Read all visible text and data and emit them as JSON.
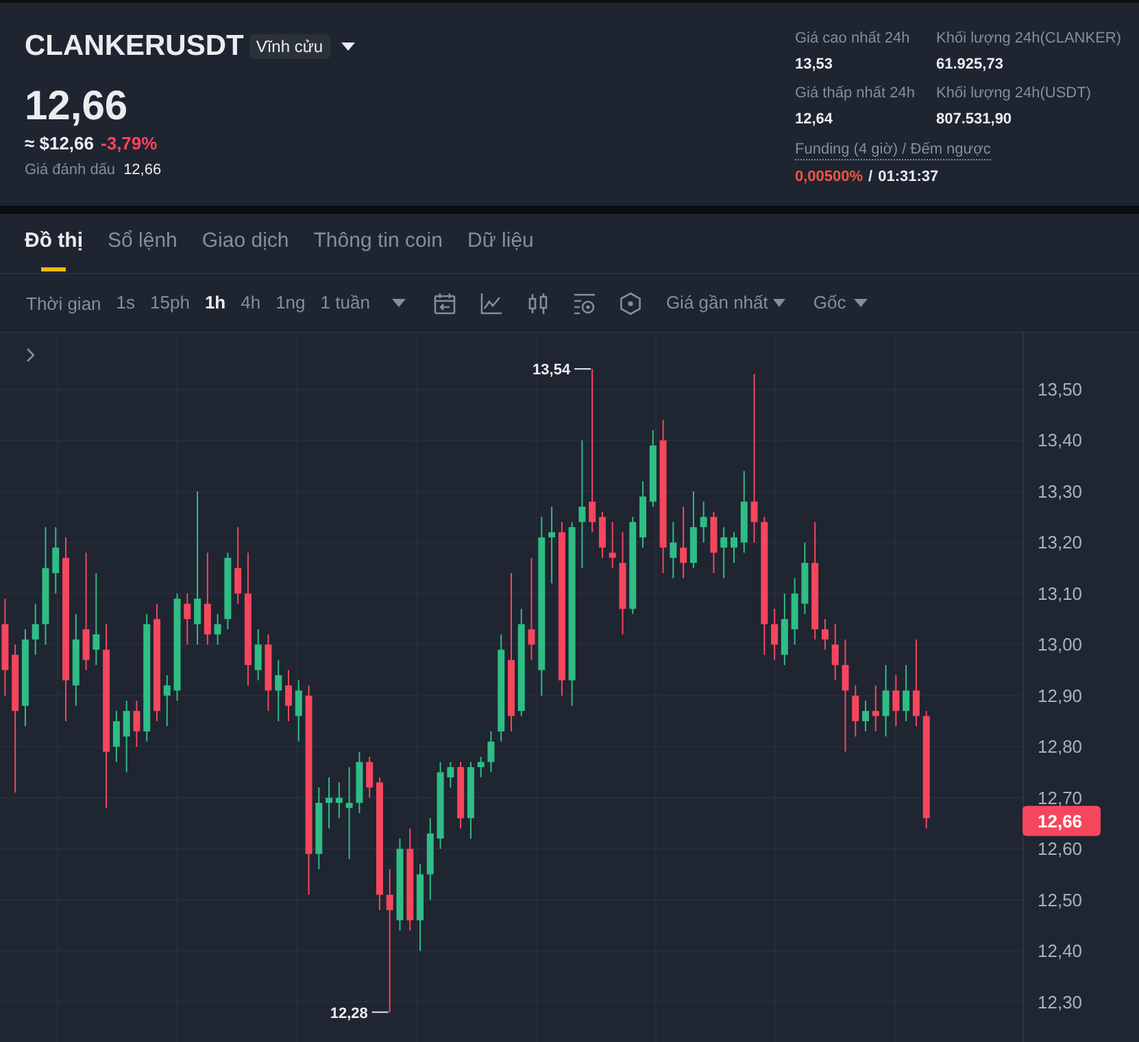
{
  "header": {
    "symbol": "CLANKERUSDT",
    "contract_type": "Vĩnh cửu",
    "last_price": "12,66",
    "usd_value": "≈ $12,66",
    "change": {
      "text": "-3,79%",
      "negative": true
    },
    "mark_price": {
      "label": "Giá đánh dấu",
      "value": "12,66"
    }
  },
  "stats": [
    {
      "label": "Giá cao nhất 24h",
      "value": "13,53"
    },
    {
      "label": "Khối lượng 24h(CLANKER)",
      "value": "61.925,73"
    },
    {
      "label": "Giá thấp nhất 24h",
      "value": "12,64"
    },
    {
      "label": "Khối lượng 24h(USDT)",
      "value": "807.531,90"
    }
  ],
  "funding": {
    "label": "Funding (4 giờ) / Đếm ngược",
    "rate": "0,00500%",
    "separator": "/",
    "countdown": "01:31:37"
  },
  "tabs": [
    {
      "label": "Đồ thị",
      "selected": true
    },
    {
      "label": "Sổ lệnh",
      "selected": false
    },
    {
      "label": "Giao dịch",
      "selected": false
    },
    {
      "label": "Thông tin coin",
      "selected": false
    },
    {
      "label": "Dữ liệu",
      "selected": false
    }
  ],
  "toolbar": {
    "time_label": "Thời gian",
    "intervals": [
      {
        "label": "1s",
        "selected": false
      },
      {
        "label": "15ph",
        "selected": false
      },
      {
        "label": "1h",
        "selected": true
      },
      {
        "label": "4h",
        "selected": false
      },
      {
        "label": "1ng",
        "selected": false
      },
      {
        "label": "1 tuần",
        "selected": false
      }
    ],
    "price_source": "Giá gần nhất",
    "scale_mode": "Gốc"
  },
  "chart": {
    "high_label": "13,54",
    "low_label": "12,28",
    "last_price_tag": "12,66",
    "chart_data": {
      "type": "candlestick",
      "grid": true,
      "categories": [
        null,
        null,
        null,
        null,
        null,
        null,
        null,
        null,
        null,
        null,
        null,
        null,
        null,
        null,
        null,
        null,
        null,
        null,
        null,
        null,
        null,
        null,
        null,
        null,
        null,
        null,
        null,
        null,
        null,
        null,
        null,
        null,
        null,
        null,
        null,
        null,
        null,
        null,
        null,
        null,
        null,
        null,
        null,
        null,
        null,
        null,
        null,
        null,
        null,
        null,
        null,
        null,
        null,
        null,
        null,
        null,
        null,
        null,
        null,
        null,
        null,
        null,
        null,
        null,
        null,
        null,
        null,
        null,
        null,
        null,
        null,
        null,
        null,
        null,
        null,
        null,
        null,
        null,
        null,
        null,
        null,
        null,
        null,
        null,
        null,
        null,
        null,
        null,
        null,
        null,
        null,
        null,
        null,
        null,
        null,
        null,
        null,
        null,
        null,
        null,
        null
      ],
      "ohlc": [
        [
          13.04,
          13.09,
          12.9,
          12.95
        ],
        [
          12.98,
          13.0,
          12.71,
          12.87
        ],
        [
          12.88,
          13.03,
          12.84,
          13.01
        ],
        [
          13.01,
          13.08,
          12.98,
          13.04
        ],
        [
          13.04,
          13.23,
          13.0,
          13.15
        ],
        [
          13.14,
          13.23,
          13.1,
          13.19
        ],
        [
          13.17,
          13.21,
          12.85,
          12.93
        ],
        [
          12.92,
          13.06,
          12.88,
          13.01
        ],
        [
          13.03,
          13.18,
          12.95,
          12.97
        ],
        [
          12.99,
          13.14,
          12.96,
          13.02
        ],
        [
          12.99,
          13.04,
          12.68,
          12.79
        ],
        [
          12.8,
          12.87,
          12.77,
          12.85
        ],
        [
          12.82,
          12.89,
          12.75,
          12.87
        ],
        [
          12.87,
          12.89,
          12.8,
          12.83
        ],
        [
          12.83,
          13.06,
          12.81,
          13.04
        ],
        [
          13.05,
          13.08,
          12.85,
          12.87
        ],
        [
          12.9,
          12.94,
          12.84,
          12.92
        ],
        [
          12.91,
          13.1,
          12.89,
          13.09
        ],
        [
          13.08,
          13.1,
          13.0,
          13.05
        ],
        [
          13.04,
          13.3,
          13.0,
          13.09
        ],
        [
          13.08,
          13.18,
          13.0,
          13.02
        ],
        [
          13.02,
          13.06,
          13.0,
          13.04
        ],
        [
          13.05,
          13.18,
          13.03,
          13.17
        ],
        [
          13.15,
          13.23,
          13.08,
          13.1
        ],
        [
          13.1,
          13.18,
          12.92,
          12.96
        ],
        [
          12.95,
          13.03,
          12.93,
          13.0
        ],
        [
          13.0,
          13.02,
          12.87,
          12.91
        ],
        [
          12.91,
          12.97,
          12.85,
          12.94
        ],
        [
          12.92,
          12.95,
          12.85,
          12.88
        ],
        [
          12.86,
          12.93,
          12.81,
          12.91
        ],
        [
          12.9,
          12.92,
          12.51,
          12.59
        ],
        [
          12.59,
          12.72,
          12.56,
          12.69
        ],
        [
          12.69,
          12.74,
          12.64,
          12.7
        ],
        [
          12.69,
          12.73,
          12.66,
          12.7
        ],
        [
          12.68,
          12.76,
          12.58,
          12.69
        ],
        [
          12.69,
          12.79,
          12.67,
          12.77
        ],
        [
          12.77,
          12.78,
          12.7,
          12.72
        ],
        [
          12.73,
          12.74,
          12.48,
          12.51
        ],
        [
          12.51,
          12.56,
          12.28,
          12.48
        ],
        [
          12.46,
          12.62,
          12.44,
          12.6
        ],
        [
          12.6,
          12.64,
          12.44,
          12.46
        ],
        [
          12.46,
          12.57,
          12.4,
          12.55
        ],
        [
          12.55,
          12.66,
          12.5,
          12.63
        ],
        [
          12.62,
          12.77,
          12.6,
          12.75
        ],
        [
          12.74,
          12.77,
          12.72,
          12.76
        ],
        [
          12.76,
          12.77,
          12.64,
          12.66
        ],
        [
          12.66,
          12.77,
          12.62,
          12.76
        ],
        [
          12.76,
          12.78,
          12.74,
          12.77
        ],
        [
          12.77,
          12.83,
          12.75,
          12.81
        ],
        [
          12.83,
          13.02,
          12.81,
          12.99
        ],
        [
          12.97,
          13.14,
          12.83,
          12.86
        ],
        [
          12.87,
          13.07,
          12.86,
          13.04
        ],
        [
          13.03,
          13.17,
          12.97,
          13.0
        ],
        [
          12.95,
          13.25,
          12.9,
          13.21
        ],
        [
          13.21,
          13.27,
          13.12,
          13.22
        ],
        [
          13.22,
          13.24,
          12.9,
          12.93
        ],
        [
          12.93,
          13.24,
          12.88,
          13.23
        ],
        [
          13.24,
          13.4,
          13.15,
          13.27
        ],
        [
          13.28,
          13.54,
          13.22,
          13.24
        ],
        [
          13.25,
          13.26,
          13.17,
          13.19
        ],
        [
          13.18,
          13.24,
          13.15,
          13.17
        ],
        [
          13.16,
          13.22,
          13.02,
          13.07
        ],
        [
          13.07,
          13.25,
          13.06,
          13.24
        ],
        [
          13.21,
          13.32,
          13.19,
          13.29
        ],
        [
          13.28,
          13.42,
          13.27,
          13.39
        ],
        [
          13.4,
          13.44,
          13.14,
          13.19
        ],
        [
          13.17,
          13.24,
          13.13,
          13.2
        ],
        [
          13.19,
          13.27,
          13.13,
          13.16
        ],
        [
          13.16,
          13.3,
          13.15,
          13.23
        ],
        [
          13.23,
          13.28,
          13.2,
          13.25
        ],
        [
          13.25,
          13.26,
          13.14,
          13.18
        ],
        [
          13.19,
          13.23,
          13.13,
          13.21
        ],
        [
          13.19,
          13.22,
          13.16,
          13.21
        ],
        [
          13.2,
          13.34,
          13.18,
          13.28
        ],
        [
          13.28,
          13.53,
          13.2,
          13.24
        ],
        [
          13.24,
          13.25,
          12.98,
          13.04
        ],
        [
          13.04,
          13.07,
          12.97,
          13.0
        ],
        [
          12.98,
          13.1,
          12.96,
          13.05
        ],
        [
          13.03,
          13.13,
          13.0,
          13.1
        ],
        [
          13.08,
          13.2,
          13.06,
          13.16
        ],
        [
          13.16,
          13.24,
          13.01,
          13.03
        ],
        [
          13.03,
          13.05,
          12.99,
          13.01
        ],
        [
          13.0,
          13.04,
          12.93,
          12.96
        ],
        [
          12.96,
          13.01,
          12.79,
          12.91
        ],
        [
          12.9,
          12.92,
          12.82,
          12.85
        ],
        [
          12.85,
          12.89,
          12.83,
          12.87
        ],
        [
          12.87,
          12.92,
          12.83,
          12.86
        ],
        [
          12.86,
          12.96,
          12.82,
          12.91
        ],
        [
          12.91,
          12.94,
          12.84,
          12.87
        ],
        [
          12.87,
          12.96,
          12.85,
          12.91
        ],
        [
          12.91,
          13.01,
          12.84,
          12.86
        ],
        [
          12.86,
          12.87,
          12.64,
          12.66
        ],
        null,
        null,
        null,
        null,
        null,
        null,
        null,
        null,
        null
      ],
      "ylim": [
        12.2216,
        13.61
      ],
      "yticks": [
        {
          "value": 13.5,
          "label": "13,50"
        },
        {
          "value": 13.4,
          "label": "13,40"
        },
        {
          "value": 13.3,
          "label": "13,30"
        },
        {
          "value": 13.2,
          "label": "13,20"
        },
        {
          "value": 13.1,
          "label": "13,10"
        },
        {
          "value": 13.0,
          "label": "13,00"
        },
        {
          "value": 12.9,
          "label": "12,90"
        },
        {
          "value": 12.8,
          "label": "12,80"
        },
        {
          "value": 12.7,
          "label": "12,70"
        },
        {
          "value": 12.6,
          "label": "12,60"
        },
        {
          "value": 12.5,
          "label": "12,50"
        },
        {
          "value": 12.4,
          "label": "12,40"
        },
        {
          "value": 12.3,
          "label": "12,30"
        }
      ]
    }
  }
}
